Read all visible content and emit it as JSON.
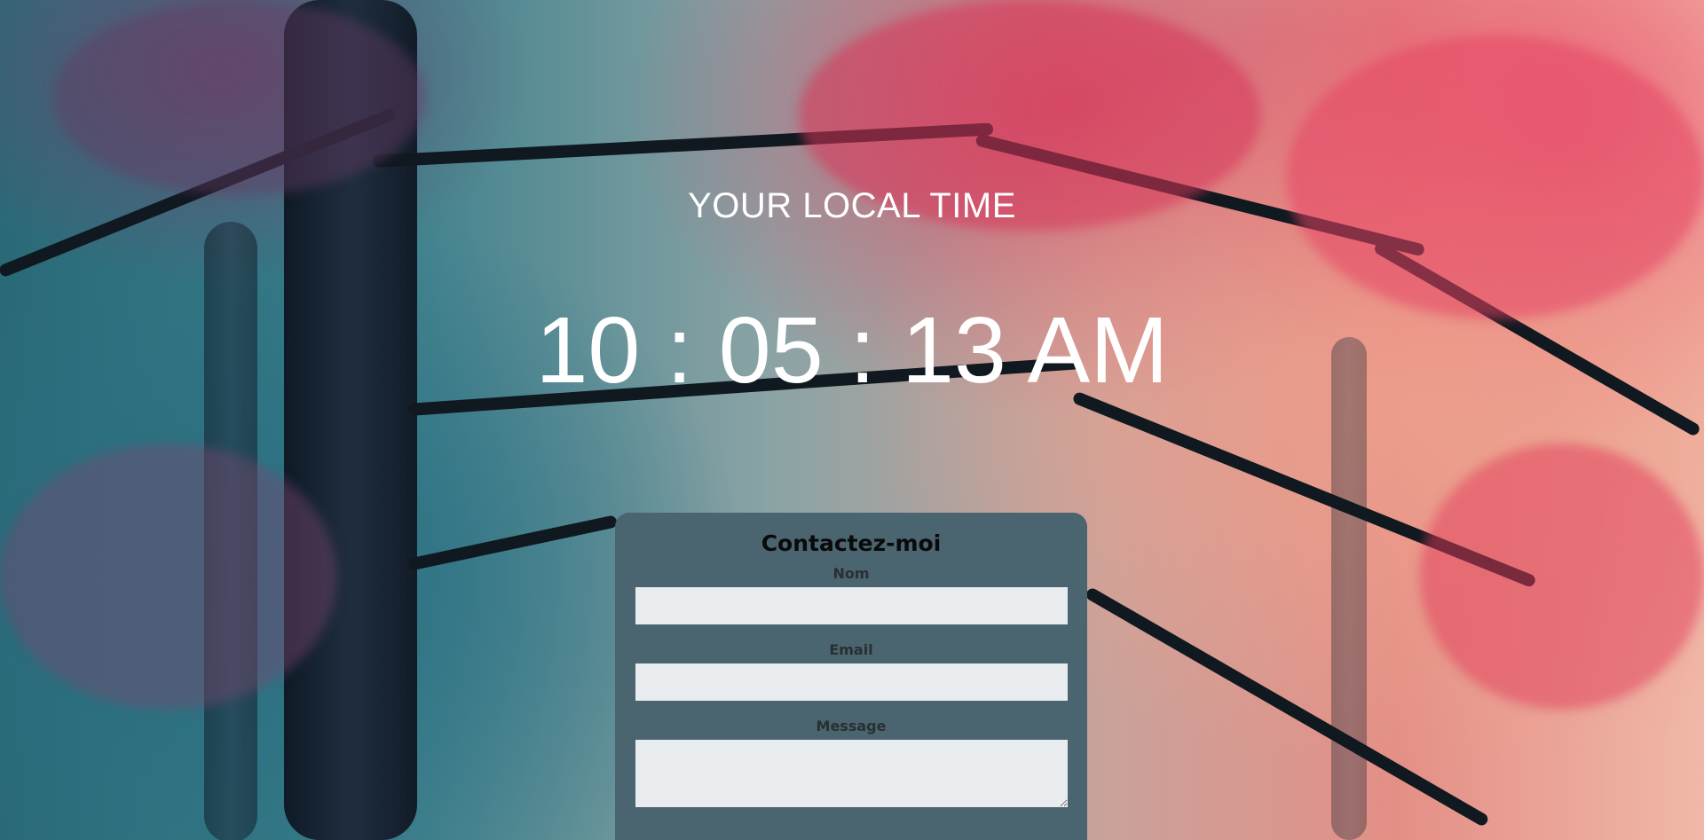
{
  "page": {
    "heading": "YOUR LOCAL TIME",
    "clock": {
      "hours": "10",
      "minutes": "05",
      "seconds": "13",
      "period": "AM",
      "display": "10 : 05 : 13 AM"
    }
  },
  "contact_form": {
    "title": "Contactez-moi",
    "fields": {
      "name": {
        "label": "Nom",
        "value": "",
        "placeholder": ""
      },
      "email": {
        "label": "Email",
        "value": "",
        "placeholder": ""
      },
      "message": {
        "label": "Message",
        "value": "",
        "placeholder": ""
      }
    }
  },
  "theme": {
    "text_color": "#ffffff",
    "card_color": "#4a6470",
    "input_color": "#e8ecee"
  }
}
